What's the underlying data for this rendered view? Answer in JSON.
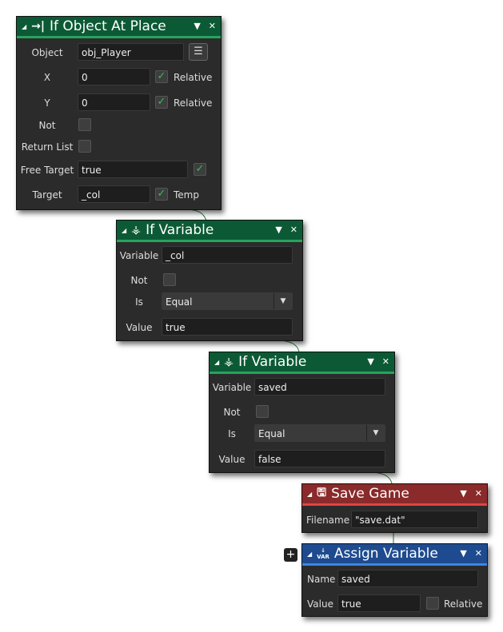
{
  "blocks": [
    {
      "title": "If Object At Place",
      "icon": "arrow-to-bar-icon",
      "color": "#0c5a35",
      "object_label": "Object",
      "object_value": "obj_Player",
      "x_label": "X",
      "x_value": "0",
      "x_relative": true,
      "relative_label": "Relative",
      "y_label": "Y",
      "y_value": "0",
      "y_relative": true,
      "not_label": "Not",
      "not_checked": false,
      "return_list_label": "Return List",
      "return_list_checked": false,
      "free_target_label": "Free Target",
      "free_target_value": "true",
      "free_target_checked": true,
      "target_label": "Target",
      "target_value": "_col",
      "temp_checked": true,
      "temp_label": "Temp"
    },
    {
      "title": "If Variable",
      "icon": "variable-branch-icon",
      "color": "#0c5a35",
      "variable_label": "Variable",
      "variable_value": "_col",
      "not_label": "Not",
      "not_checked": false,
      "is_label": "Is",
      "is_value": "Equal",
      "value_label": "Value",
      "value_value": "true"
    },
    {
      "title": "If Variable",
      "icon": "variable-branch-icon",
      "color": "#0c5a35",
      "variable_label": "Variable",
      "variable_value": "saved",
      "not_label": "Not",
      "not_checked": false,
      "is_label": "Is",
      "is_value": "Equal",
      "value_label": "Value",
      "value_value": "false"
    },
    {
      "title": "Save Game",
      "icon": "floppy-disk-icon",
      "color": "#8a2a2a",
      "filename_label": "Filename",
      "filename_value": "\"save.dat\""
    },
    {
      "title": "Assign Variable",
      "icon": "var-assign-icon",
      "icon_text": "VAR",
      "color": "#1e4b8f",
      "name_label": "Name",
      "name_value": "saved",
      "value_label": "Value",
      "value_value": "true",
      "relative_label": "Relative",
      "relative_checked": false
    }
  ],
  "add_button": "+",
  "collapse_glyph": "◢",
  "menu_glyph": "▼",
  "close_glyph": "✕",
  "check_glyph": "✓"
}
